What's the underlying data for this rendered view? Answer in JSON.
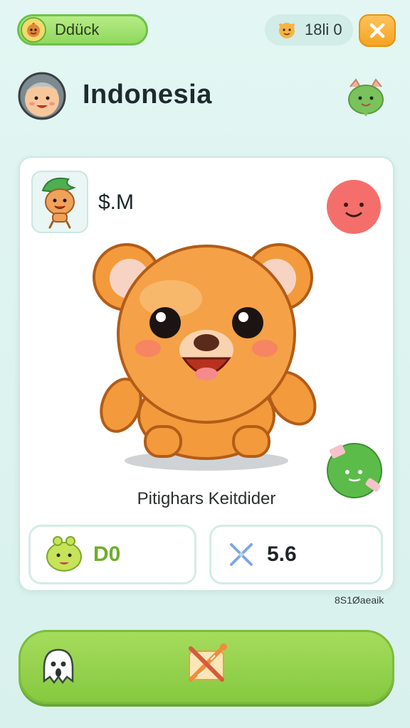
{
  "top_bar": {
    "user_pill_label": "Ddück",
    "currency_label": "18li 0",
    "close_icon": "close-icon"
  },
  "header": {
    "title": "Indonesia"
  },
  "card": {
    "amount": "$.M",
    "character_name": "Pitighars Keitdider",
    "stats": {
      "left_value": "D0",
      "right_value": "5.6"
    },
    "footnote": "8S1Øaeaik"
  },
  "colors": {
    "accent_green": "#8fd85d",
    "close_orange": "#f5a421",
    "bear_orange": "#f39b3c",
    "smile_red": "#f26a6a"
  },
  "icons": [
    "grandpa-avatar-icon",
    "dragon-icon",
    "smile-face-icon",
    "leaf-face-icon",
    "ghost-icon",
    "crossed-swords-icon"
  ]
}
